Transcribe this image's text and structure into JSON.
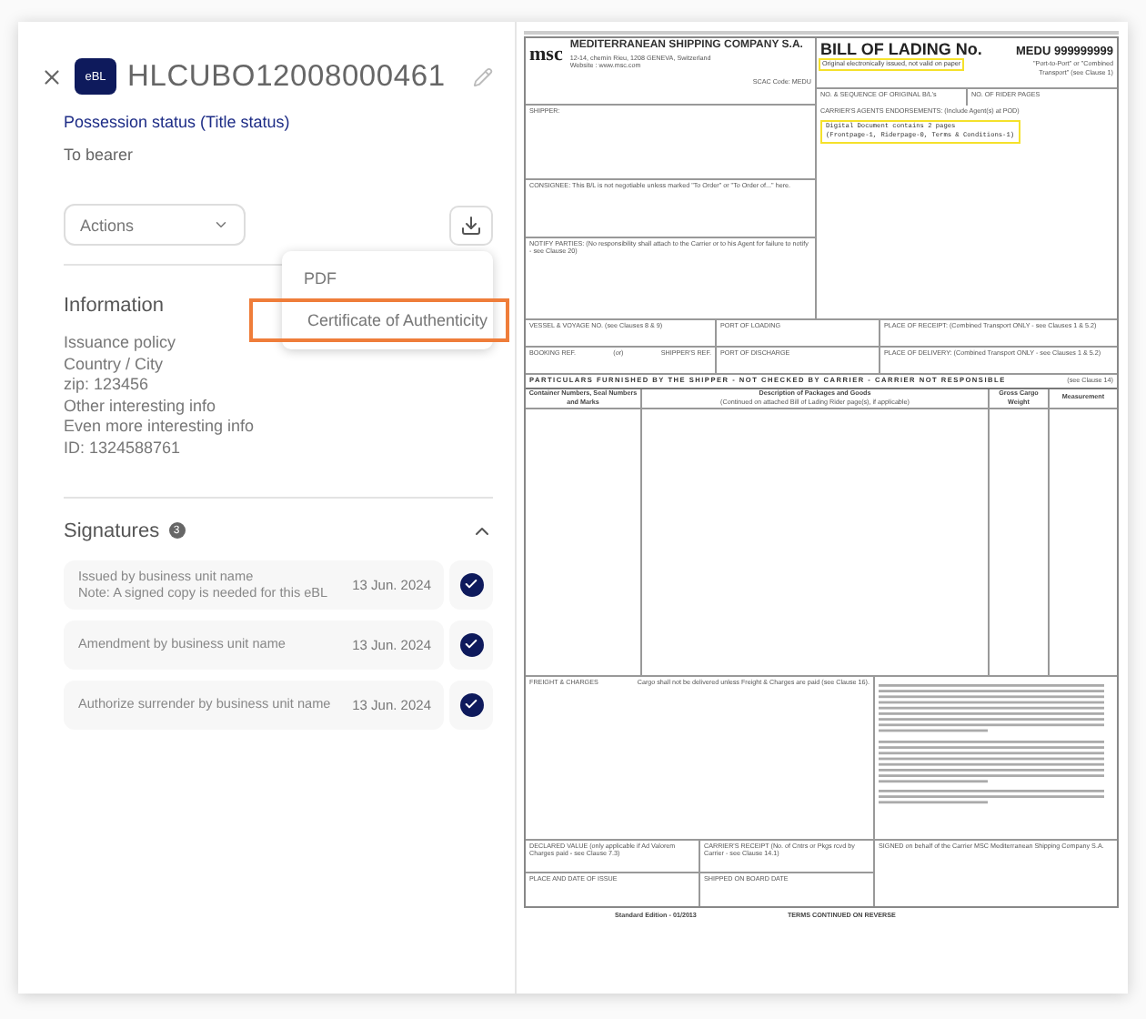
{
  "panel": {
    "badge": "eBL",
    "title": "HLCUBO12008000461",
    "status_label": "Possession status (Title status)",
    "status_value": "To bearer"
  },
  "actions": {
    "label": "Actions"
  },
  "download_menu": {
    "open": true,
    "items": [
      {
        "label": "PDF",
        "highlighted": false
      },
      {
        "label": "Certificate of Authenticity",
        "highlighted": true
      }
    ]
  },
  "information": {
    "title": "Information",
    "lines": [
      "Issuance policy",
      "Country / City",
      "zip: 123456",
      "Other interesting info",
      "Even more interesting info",
      "ID: 1324588761"
    ]
  },
  "signatures": {
    "title": "Signatures",
    "count": "3",
    "expanded": true,
    "items": [
      {
        "text": "Issued by business unit name",
        "note": "Note: A signed copy is needed for this eBL",
        "date": "13 Jun. 2024",
        "signed": true
      },
      {
        "text": "Amendment by business unit name",
        "date": "13 Jun. 2024",
        "signed": true
      },
      {
        "text": "Authorize surrender by business unit name",
        "date": "13 Jun. 2024",
        "signed": true
      }
    ]
  },
  "document": {
    "logo": "msc",
    "company": "MEDITERRANEAN SHIPPING COMPANY S.A.",
    "address": "12-14, chemin Rieu, 1208 GENEVA, Switzerland",
    "website": "Website : www.msc.com",
    "scac": "SCAC Code: MEDU",
    "bl_title": "BILL OF LADING No.",
    "bl_number": "MEDU 999999999",
    "paper_note": {
      "text": "Original electronically issued, not valid on paper",
      "highlighted": true
    },
    "transport_note": "\"Port-to-Port\" or \"Combined Transport\" (see Clause 1)",
    "ref_fields": [
      "NO. & SEQUENCE OF ORIGINAL B/L's",
      "NO. OF RIDER PAGES"
    ],
    "left_fields": [
      "SHIPPER:",
      "CONSIGNEE: This B/L is not negotiable unless marked \"To Order\" or \"To Order of...\" here.",
      "NOTIFY PARTIES: (No responsibility shall attach to the Carrier or to his Agent for failure to notify - see Clause 20)"
    ],
    "endorsements": {
      "label": "CARRIER'S AGENTS ENDORSEMENTS: (Include Agent(s) at POD)",
      "lines": [
        "Digital Document contains 2 pages",
        "(Frontpage-1, Riderpage-0, Terms & Conditions-1)"
      ],
      "highlighted": true
    },
    "route_rows": [
      [
        [
          "VESSEL & VOYAGE NO. (see Clauses 8 & 9)"
        ],
        [
          "PORT OF LOADING"
        ],
        [
          "PLACE OF RECEIPT: (Combined Transport ONLY - see Clauses 1 & 5.2)"
        ]
      ],
      [
        [
          "BOOKING REF.",
          "(or)",
          "SHIPPER'S REF."
        ],
        [
          "PORT OF DISCHARGE"
        ],
        [
          "PLACE OF DELIVERY: (Combined Transport ONLY - see Clauses 1 & 5.2)"
        ]
      ]
    ],
    "particulars": {
      "banner": "PARTICULARS FURNISHED BY THE SHIPPER - NOT CHECKED BY CARRIER - CARRIER NOT RESPONSIBLE",
      "clause": "(see Clause 14)",
      "columns": [
        {
          "title": "Container Numbers, Seal Numbers and Marks"
        },
        {
          "title": "Description of Packages and Goods",
          "subtitle": "(Continued on attached Bill of Lading Rider page(s), if applicable)"
        },
        {
          "title": "Gross Cargo Weight"
        },
        {
          "title": "Measurement"
        }
      ]
    },
    "freight": {
      "label": "FREIGHT & CHARGES",
      "note": "Cargo shall not be delivered unless Freight & Charges are paid (see Clause 16)."
    },
    "bottom_rows": [
      [
        "DECLARED VALUE (only applicable if Ad Valorem Charges paid - see Clause 7.3)",
        "CARRIER'S RECEIPT (No. of Cntrs or Pkgs rcvd by Carrier - see Clause 14.1)"
      ],
      [
        "PLACE AND DATE OF ISSUE",
        "SHIPPED ON BOARD DATE"
      ]
    ],
    "signed_on_behalf": "SIGNED on behalf of the Carrier MSC Mediterranean Shipping Company S.A.",
    "footer": [
      "Standard Edition - 01/2013",
      "TERMS CONTINUED ON REVERSE"
    ]
  }
}
